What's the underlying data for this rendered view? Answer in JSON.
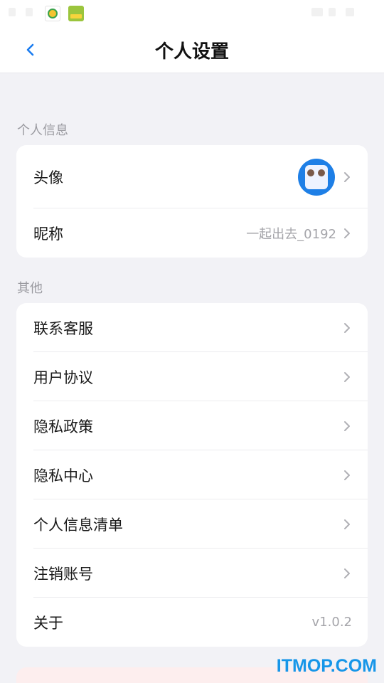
{
  "header": {
    "title": "个人设置",
    "back_icon": "chevron-left-icon",
    "accent_color": "#1a7cf0"
  },
  "sections": {
    "personal": {
      "label": "个人信息",
      "avatar_label": "头像",
      "nickname_label": "昵称",
      "nickname_value": "一起出去_0192"
    },
    "other": {
      "label": "其他",
      "items": [
        {
          "label": "联系客服"
        },
        {
          "label": "用户协议"
        },
        {
          "label": "隐私政策"
        },
        {
          "label": "隐私中心"
        },
        {
          "label": "个人信息清单"
        },
        {
          "label": "注销账号"
        }
      ],
      "about_label": "关于",
      "about_value": "v1.0.2"
    }
  },
  "watermark": "ITMOP.COM"
}
